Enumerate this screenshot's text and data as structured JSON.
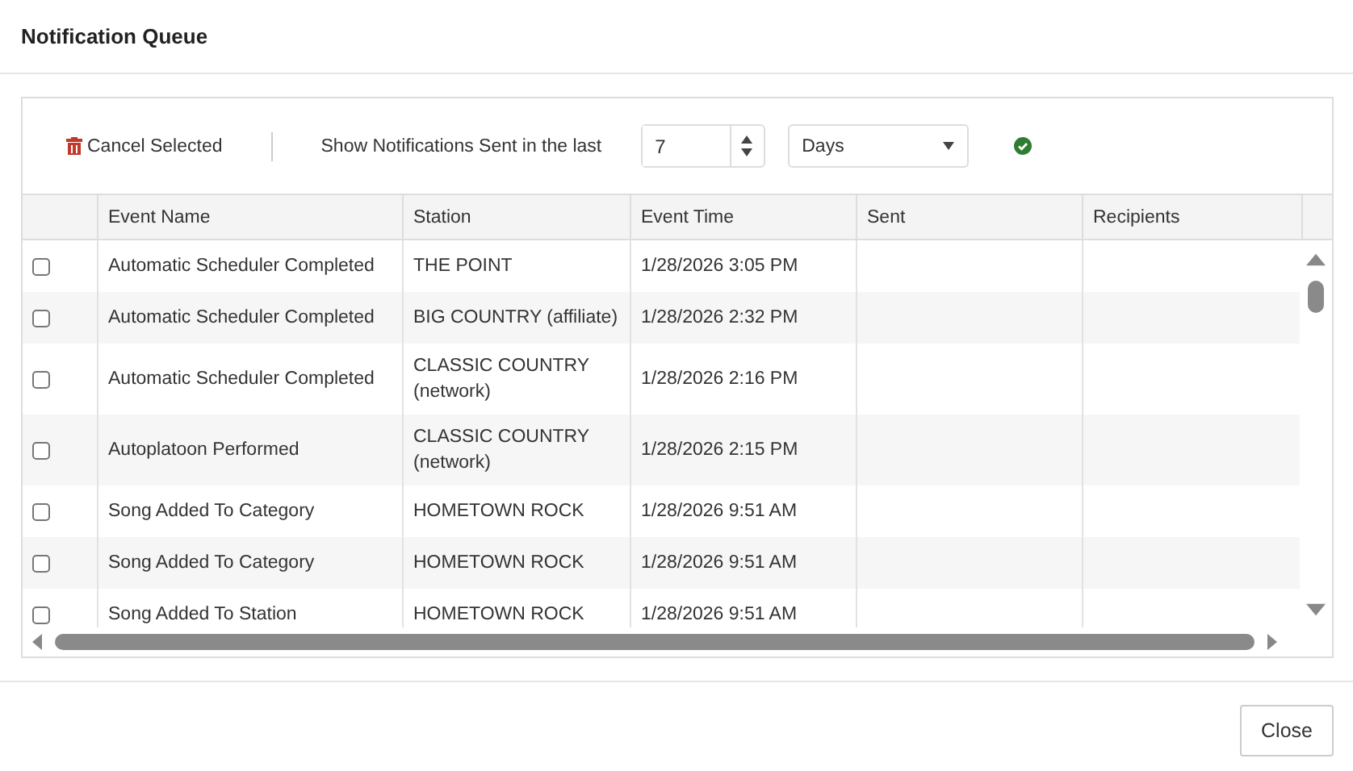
{
  "window": {
    "title": "Notification Queue"
  },
  "toolbar": {
    "cancel_label": "Cancel Selected",
    "filter_label": "Show Notifications Sent in the last",
    "amount": "7",
    "unit": "Days"
  },
  "table": {
    "columns": [
      "Event Name",
      "Station",
      "Event Time",
      "Sent",
      "Recipients"
    ],
    "rows": [
      {
        "checked": false,
        "cells": [
          "Automatic Scheduler Completed",
          "THE POINT",
          "1/28/2026 3:05 PM",
          "",
          ""
        ]
      },
      {
        "checked": false,
        "cells": [
          "Automatic Scheduler Completed",
          "BIG COUNTRY (affiliate)",
          "1/28/2026 2:32 PM",
          "",
          ""
        ]
      },
      {
        "checked": false,
        "cells": [
          "Automatic Scheduler Completed",
          "CLASSIC COUNTRY (network)",
          "1/28/2026 2:16 PM",
          "",
          ""
        ]
      },
      {
        "checked": false,
        "cells": [
          "Autoplatoon Performed",
          "CLASSIC COUNTRY (network)",
          "1/28/2026 2:15 PM",
          "",
          ""
        ]
      },
      {
        "checked": false,
        "cells": [
          "Song Added To Category",
          "HOMETOWN ROCK",
          "1/28/2026 9:51 AM",
          "",
          ""
        ]
      },
      {
        "checked": false,
        "cells": [
          "Song Added To Category",
          "HOMETOWN ROCK",
          "1/28/2026 9:51 AM",
          "",
          ""
        ]
      },
      {
        "checked": false,
        "cells": [
          "Song Added To Station",
          "HOMETOWN ROCK",
          "1/28/2026 9:51 AM",
          "",
          ""
        ]
      }
    ]
  },
  "buttons": [
    "Close"
  ]
}
